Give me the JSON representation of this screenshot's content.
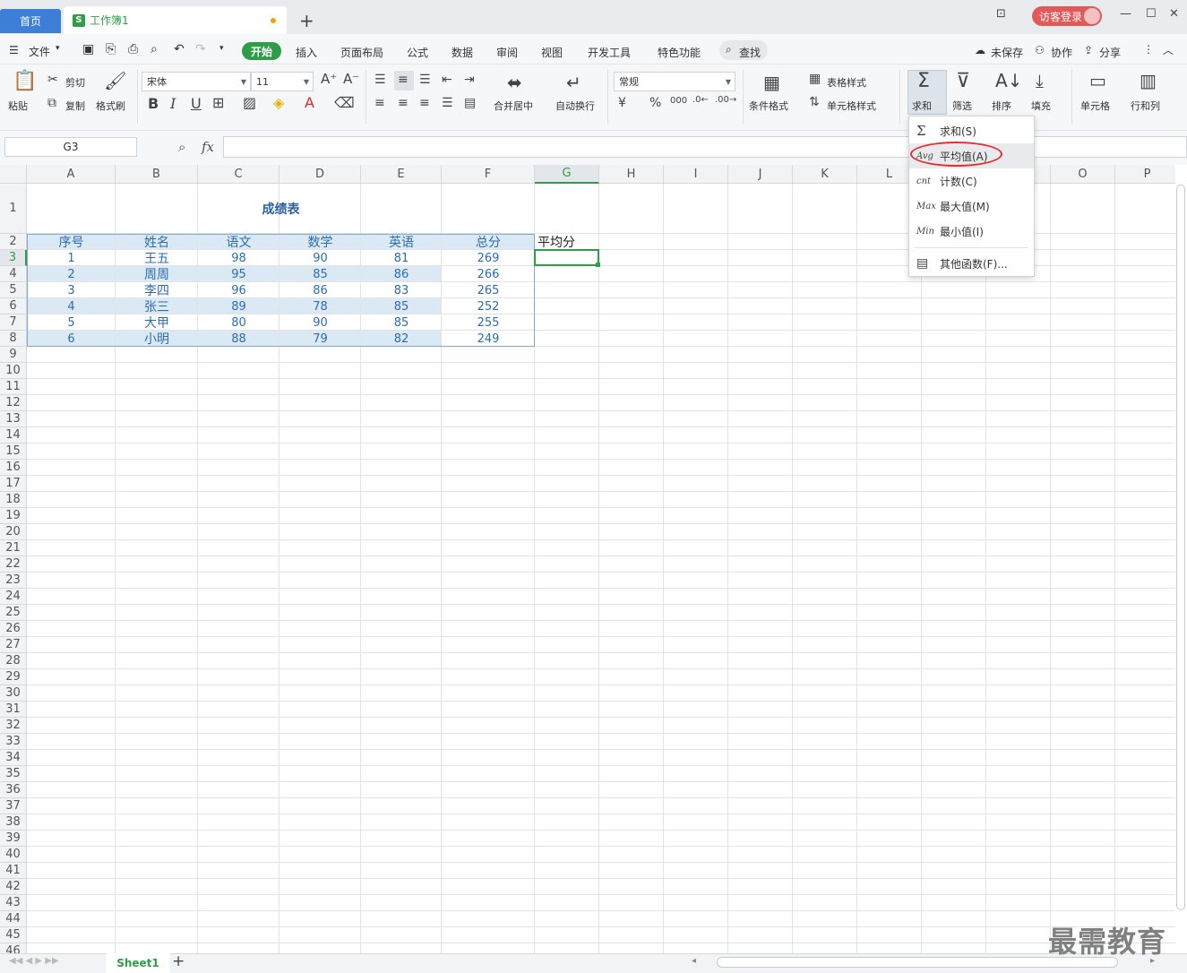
{
  "tabs": {
    "home": "首页",
    "doc": "工作簿1",
    "new_tab": "+"
  },
  "window": {
    "login": "访客登录",
    "minimize": "—",
    "maximize": "☐",
    "close": "✕",
    "layout": "⊡"
  },
  "menu": {
    "file": "文件",
    "items": [
      "开始",
      "插入",
      "页面布局",
      "公式",
      "数据",
      "审阅",
      "视图",
      "开发工具",
      "特色功能"
    ],
    "search": "查找",
    "unsaved": "未保存",
    "collab": "协作",
    "share": "分享"
  },
  "ribbon": {
    "paste": "粘贴",
    "cut": "剪切",
    "copy": "复制",
    "format_painter": "格式刷",
    "font_name": "宋体",
    "font_size": "11",
    "merge_center": "合并居中",
    "wrap_text": "自动换行",
    "number_format": "常规",
    "cond_format": "条件格式",
    "table_style": "表格样式",
    "cell_style": "单元格样式",
    "sum": "求和",
    "filter": "筛选",
    "sort": "排序",
    "fill": "填充",
    "cells": "单元格",
    "row_col": "行和列"
  },
  "formula_bar": {
    "cell_ref": "G3",
    "fx": "fx",
    "value": ""
  },
  "columns": [
    "A",
    "B",
    "C",
    "D",
    "E",
    "F",
    "G",
    "H",
    "I",
    "J",
    "K",
    "L",
    "M",
    "N",
    "O",
    "P"
  ],
  "sheet": {
    "title": "成绩表",
    "headers": [
      "序号",
      "姓名",
      "语文",
      "数学",
      "英语",
      "总分"
    ],
    "extra_header": "平均分",
    "rows": [
      [
        "1",
        "王五",
        "98",
        "90",
        "81",
        "269"
      ],
      [
        "2",
        "周周",
        "95",
        "85",
        "86",
        "266"
      ],
      [
        "3",
        "李四",
        "96",
        "86",
        "83",
        "265"
      ],
      [
        "4",
        "张三",
        "89",
        "78",
        "85",
        "252"
      ],
      [
        "5",
        "大甲",
        "80",
        "90",
        "85",
        "255"
      ],
      [
        "6",
        "小明",
        "88",
        "79",
        "82",
        "249"
      ]
    ]
  },
  "dropdown": {
    "items": [
      {
        "icon": "Σ",
        "label": "求和(S)"
      },
      {
        "icon": "Avg",
        "label": "平均值(A)"
      },
      {
        "icon": "cnt",
        "label": "计数(C)"
      },
      {
        "icon": "Max",
        "label": "最大值(M)"
      },
      {
        "icon": "Min",
        "label": "最小值(I)"
      }
    ],
    "more": "其他函数(F)..."
  },
  "sheet_tabs": {
    "active": "Sheet1",
    "add": "+"
  },
  "watermark": "最需教育"
}
